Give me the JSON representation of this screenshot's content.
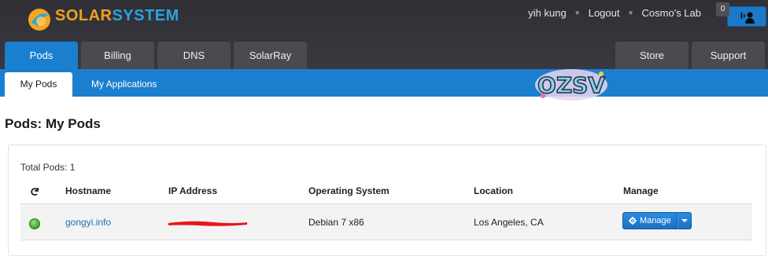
{
  "brand": {
    "solar": "SOLAR",
    "system": "SYSTEM"
  },
  "header": {
    "user": "yih kung",
    "logout": "Logout",
    "lab": "Cosmo's Lab",
    "notification_count": "0"
  },
  "tabs": {
    "pods": "Pods",
    "billing": "Billing",
    "dns": "DNS",
    "solarray": "SolarRay",
    "store": "Store",
    "support": "Support"
  },
  "subnav": {
    "my_pods": "My Pods",
    "my_applications": "My Applications"
  },
  "sticker_text": "OZSV",
  "page": {
    "title": "Pods: My Pods"
  },
  "panel": {
    "total": "Total Pods: 1",
    "columns": {
      "hostname": "Hostname",
      "ip": "IP Address",
      "os": "Operating System",
      "location": "Location",
      "manage": "Manage"
    },
    "rows": [
      {
        "hostname": "gongyi.info",
        "os": "Debian 7 x86",
        "location": "Los Angeles, CA",
        "manage_label": "Manage"
      }
    ]
  },
  "colors": {
    "accent": "#1b7fd0",
    "header_bg": "#33333a",
    "link": "#1f6fb5",
    "status_ok": "#3aa52a"
  },
  "icons": {
    "refresh": "refresh-icon",
    "gear": "gear-icon",
    "status": "status-online-icon",
    "notification": "notification-icon"
  }
}
